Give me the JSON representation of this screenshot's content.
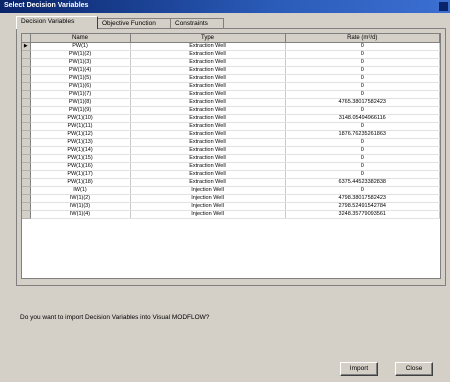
{
  "window": {
    "title": "Select Decision Variables"
  },
  "tabs": [
    {
      "label": "Decision Variables"
    },
    {
      "label": "Objective Function"
    },
    {
      "label": "Constraints"
    }
  ],
  "table": {
    "columns": [
      "Name",
      "Type",
      "Rate (m³/d)"
    ],
    "current_row_marker": "▶",
    "rows": [
      {
        "name": "PW(1)",
        "type": "Extraction Well",
        "rate": "0"
      },
      {
        "name": "PW(1)(2)",
        "type": "Extraction Well",
        "rate": "0"
      },
      {
        "name": "PW(1)(3)",
        "type": "Extraction Well",
        "rate": "0"
      },
      {
        "name": "PW(1)(4)",
        "type": "Extraction Well",
        "rate": "0"
      },
      {
        "name": "PW(1)(5)",
        "type": "Extraction Well",
        "rate": "0"
      },
      {
        "name": "PW(1)(6)",
        "type": "Extraction Well",
        "rate": "0"
      },
      {
        "name": "PW(1)(7)",
        "type": "Extraction Well",
        "rate": "0"
      },
      {
        "name": "PW(1)(8)",
        "type": "Extraction Well",
        "rate": "4765.38017582423"
      },
      {
        "name": "PW(1)(9)",
        "type": "Extraction Well",
        "rate": "0"
      },
      {
        "name": "PW(1)(10)",
        "type": "Extraction Well",
        "rate": "3148.05494966116"
      },
      {
        "name": "PW(1)(11)",
        "type": "Extraction Well",
        "rate": "0"
      },
      {
        "name": "PW(1)(12)",
        "type": "Extraction Well",
        "rate": "1876.76235261863"
      },
      {
        "name": "PW(1)(13)",
        "type": "Extraction Well",
        "rate": "0"
      },
      {
        "name": "PW(1)(14)",
        "type": "Extraction Well",
        "rate": "0"
      },
      {
        "name": "PW(1)(15)",
        "type": "Extraction Well",
        "rate": "0"
      },
      {
        "name": "PW(1)(16)",
        "type": "Extraction Well",
        "rate": "0"
      },
      {
        "name": "PW(1)(17)",
        "type": "Extraction Well",
        "rate": "0"
      },
      {
        "name": "PW(1)(18)",
        "type": "Extraction Well",
        "rate": "6375.44523382838"
      },
      {
        "name": "IW(1)",
        "type": "Injection Well",
        "rate": "0"
      },
      {
        "name": "IW(1)(2)",
        "type": "Injection Well",
        "rate": "4798.38017582423"
      },
      {
        "name": "IW(1)(3)",
        "type": "Injection Well",
        "rate": "2798.52491542784"
      },
      {
        "name": "IW(1)(4)",
        "type": "Injection Well",
        "rate": "3248.35779093561"
      }
    ]
  },
  "message": "Do you want to import Decision Variables into Visual MODFLOW?",
  "buttons": {
    "import": "Import",
    "close": "Close"
  }
}
